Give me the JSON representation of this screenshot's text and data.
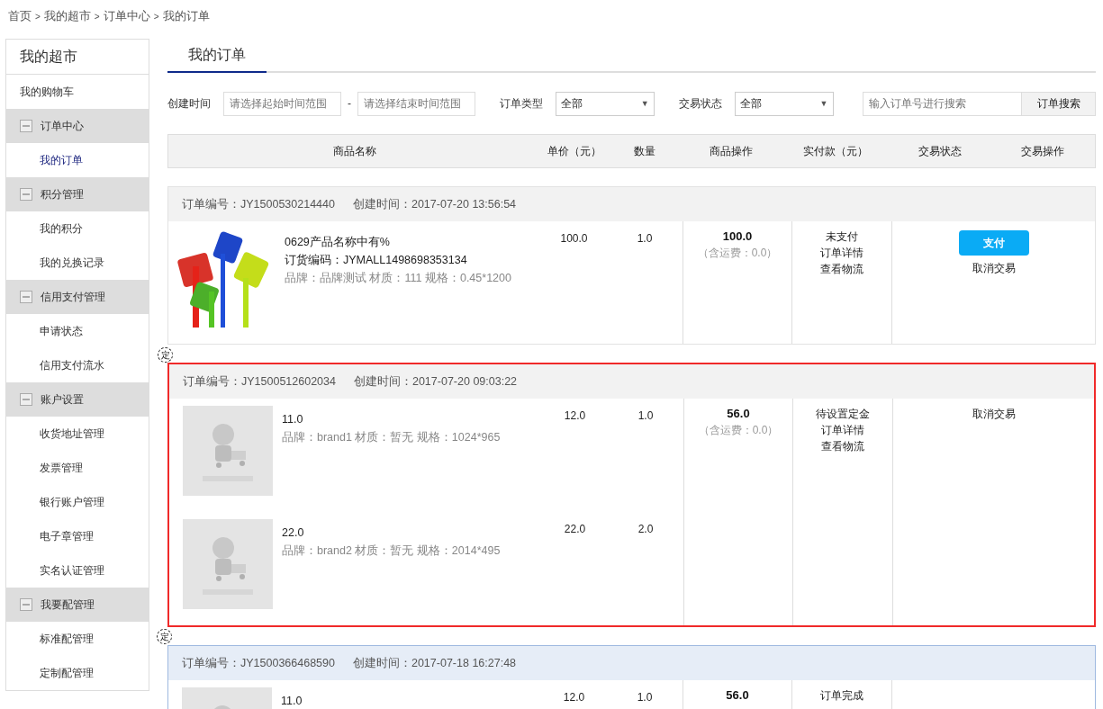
{
  "breadcrumb": [
    "首页",
    "我的超市",
    "订单中心",
    "我的订单"
  ],
  "breadcrumb_separator": ">",
  "sidebar": {
    "title": "我的超市",
    "items": [
      {
        "kind": "link",
        "label": "我的购物车",
        "selected": false
      },
      {
        "kind": "group",
        "label": "订单中心",
        "expanded": true,
        "children": [
          {
            "label": "我的订单",
            "selected": true
          }
        ]
      },
      {
        "kind": "group",
        "label": "积分管理",
        "expanded": true,
        "children": [
          {
            "label": "我的积分",
            "selected": false
          },
          {
            "label": "我的兑换记录",
            "selected": false
          }
        ]
      },
      {
        "kind": "group",
        "label": "信用支付管理",
        "expanded": true,
        "children": [
          {
            "label": "申请状态",
            "selected": false
          },
          {
            "label": "信用支付流水",
            "selected": false
          }
        ]
      },
      {
        "kind": "group",
        "label": "账户设置",
        "expanded": true,
        "children": [
          {
            "label": "收货地址管理",
            "selected": false
          },
          {
            "label": "发票管理",
            "selected": false
          },
          {
            "label": "银行账户管理",
            "selected": false
          },
          {
            "label": "电子章管理",
            "selected": false
          },
          {
            "label": "实名认证管理",
            "selected": false
          }
        ]
      },
      {
        "kind": "group",
        "label": "我要配管理",
        "expanded": true,
        "children": [
          {
            "label": "标准配管理",
            "selected": false
          },
          {
            "label": "定制配管理",
            "selected": false
          }
        ]
      }
    ]
  },
  "tabs": [
    {
      "label": "我的订单",
      "selected": true
    }
  ],
  "filters": {
    "created_label": "创建时间",
    "start": {
      "placeholder": "请选择起始时间范围"
    },
    "dash": "-",
    "end": {
      "placeholder": "请选择结束时间范围"
    },
    "type_label": "订单类型",
    "type_value": "全部",
    "type_caret": "▼",
    "status_label": "交易状态",
    "status_value": "全部",
    "status_caret": "▼",
    "search": {
      "placeholder": "输入订单号进行搜索"
    },
    "search_button": "订单搜索"
  },
  "table": {
    "columns": [
      "商品名称",
      "单价（元）",
      "数量",
      "商品操作",
      "实付款（元）",
      "交易状态",
      "交易操作"
    ]
  },
  "orders": [
    {
      "number_label": "订单编号：JY1500530214440",
      "time_label": "创建时间：2017-07-20 13:56:54",
      "selected": false,
      "hovered": false,
      "products": [
        {
          "name": "0629产品名称中有%",
          "code": "订货编码：JYMALL1498698353134",
          "spec": "品牌：品牌测试 材质：111 规格：0.45*1200",
          "price": "100.0",
          "quantity": "1.0"
        }
      ],
      "paid": "100.0",
      "shipping": "（含运费：0.0）",
      "status": [
        "未支付",
        "订单详情",
        "查看物流"
      ],
      "actions": [
        {
          "kind": "button",
          "label": "支付"
        },
        {
          "kind": "link",
          "label": "取消交易"
        }
      ]
    },
    {
      "badge": "定",
      "number_label": "订单编号：JY1500512602034",
      "time_label": "创建时间：2017-07-20 09:03:22",
      "selected": true,
      "hovered": false,
      "products": [
        {
          "kind": "placeholder",
          "name": "11.0",
          "spec": "品牌：brand1 材质：暂无 规格：1024*965",
          "price": "12.0",
          "quantity": "1.0"
        },
        {
          "kind": "placeholder",
          "name": "22.0",
          "spec": "品牌：brand2 材质：暂无 规格：2014*495",
          "price": "22.0",
          "quantity": "2.0"
        }
      ],
      "paid": "56.0",
      "shipping": "（含运费：0.0）",
      "status": [
        "待设置定金",
        "订单详情",
        "查看物流"
      ],
      "actions": [
        {
          "kind": "link",
          "label": "取消交易"
        }
      ]
    },
    {
      "badge": "定",
      "number_label": "订单编号：JY1500366468590",
      "time_label": "创建时间：2017-07-18 16:27:48",
      "selected": false,
      "hovered": true,
      "products": [
        {
          "kind": "placeholder",
          "name": "11.0",
          "price": "12.0",
          "quantity": "1.0"
        }
      ],
      "paid": "56.0",
      "status": [
        "订单完成"
      ]
    }
  ]
}
